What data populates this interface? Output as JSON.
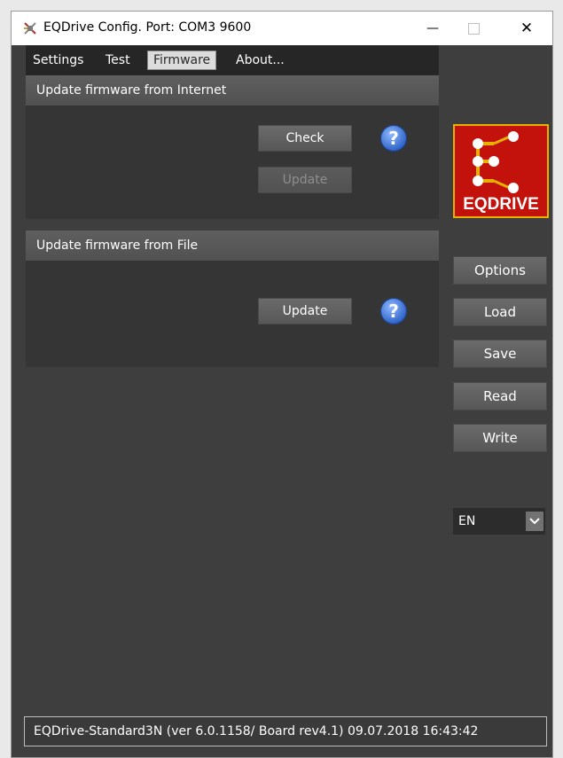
{
  "window": {
    "title": "EQDrive Config. Port: COM3 9600",
    "minimize_glyph": "—",
    "close_glyph": "✕"
  },
  "tabs": [
    {
      "label": "Settings"
    },
    {
      "label": "Test"
    },
    {
      "label": "Firmware",
      "active": true
    },
    {
      "label": "About..."
    }
  ],
  "internet_group": {
    "header": "Update firmware from Internet",
    "check_label": "Check",
    "update_label": "Update",
    "update_enabled": false,
    "help_glyph": "?"
  },
  "file_group": {
    "header": "Update firmware from File",
    "update_label": "Update",
    "help_glyph": "?"
  },
  "logo": {
    "text": "EQDRIVE",
    "background": "#c3110b",
    "border": "#e7b100",
    "node_color": "#ffffff",
    "link_color": "#e7b100"
  },
  "side_buttons": [
    {
      "label": "Options"
    },
    {
      "label": "Load"
    },
    {
      "label": "Save"
    },
    {
      "label": "Read"
    },
    {
      "label": "Write"
    }
  ],
  "language": {
    "value": "EN"
  },
  "status": {
    "text": "EQDrive-Standard3N (ver 6.0.1158/ Board rev4.1) 09.07.2018 16:43:42"
  },
  "icons": {
    "app": "satellite-dish-icon",
    "help": "question-help-icon",
    "dropdown": "chevron-down-icon"
  }
}
